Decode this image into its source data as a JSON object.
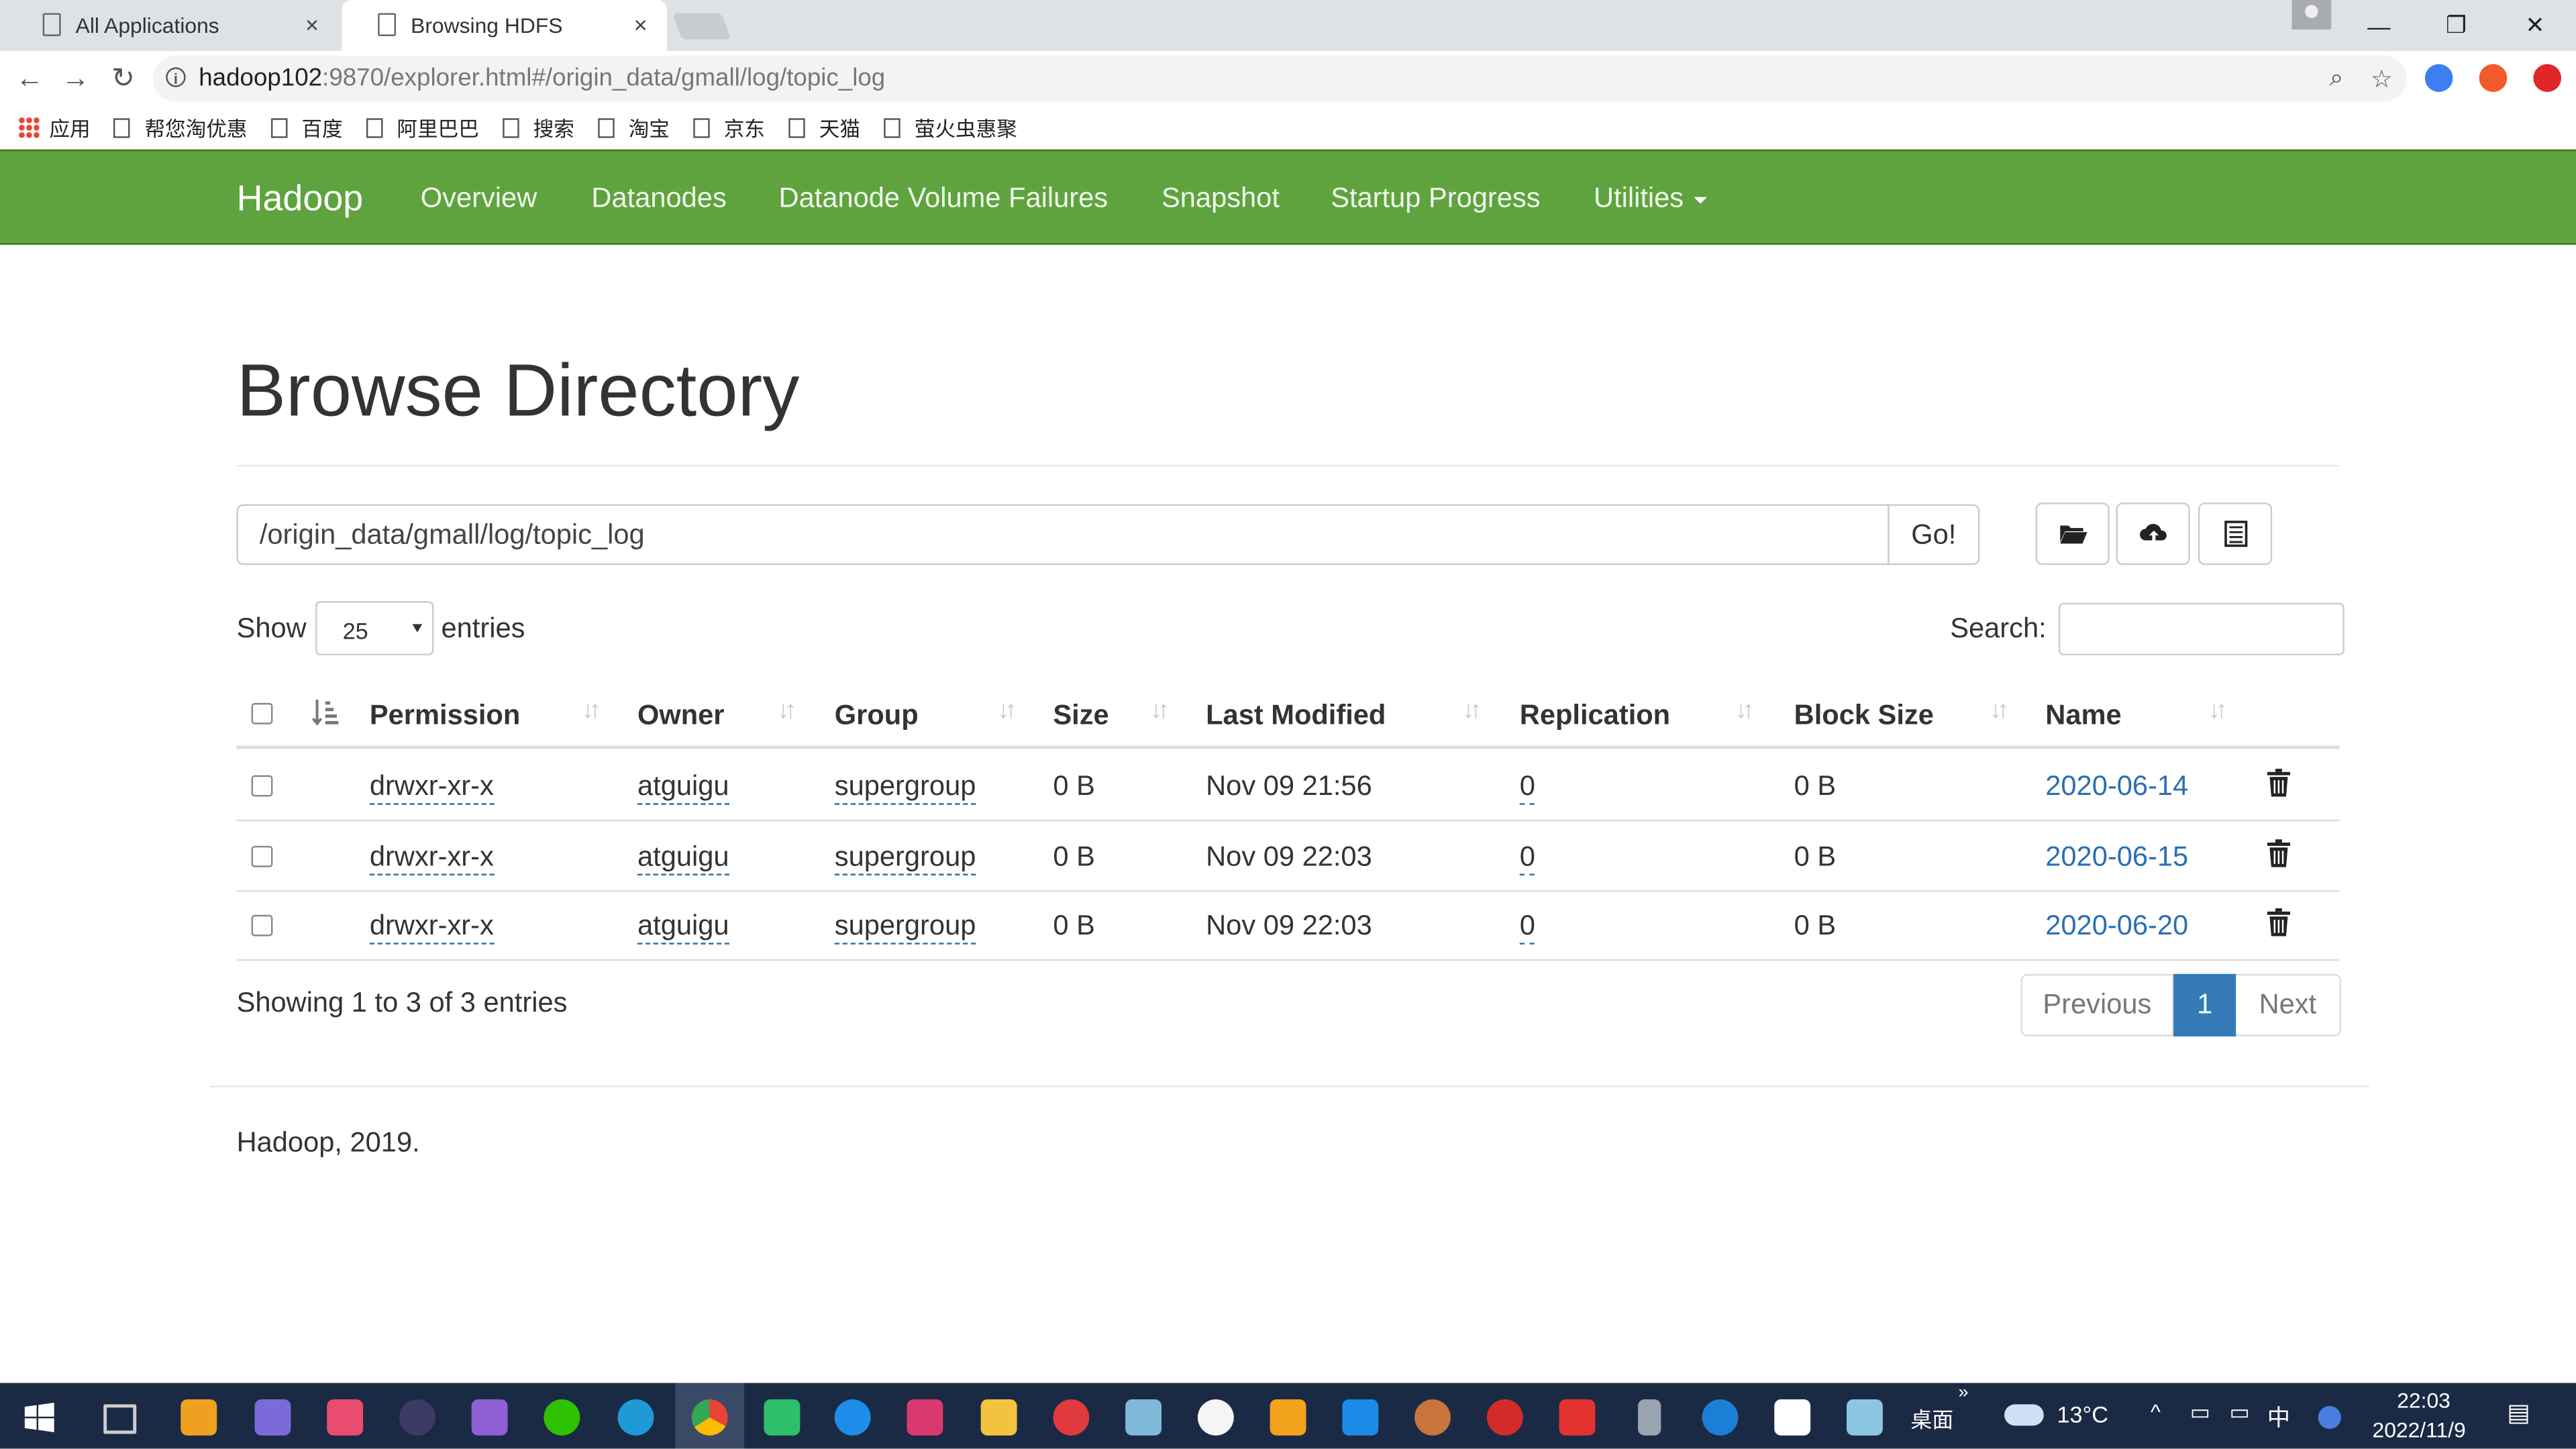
{
  "browser": {
    "tabs": [
      {
        "label": "All Applications",
        "close": "×"
      },
      {
        "label": "Browsing HDFS",
        "close": "×"
      }
    ],
    "url_host": "hadoop102",
    "url_rest": ":9870/explorer.html#/origin_data/gmall/log/topic_log",
    "bookmarks": [
      "应用",
      "帮您淘优惠",
      "百度",
      "阿里巴巴",
      "搜索",
      "淘宝",
      "京东",
      "天猫",
      "萤火虫惠聚"
    ]
  },
  "navbar": {
    "brand": "Hadoop",
    "items": [
      "Overview",
      "Datanodes",
      "Datanode Volume Failures",
      "Snapshot",
      "Startup Progress",
      "Utilities"
    ]
  },
  "page": {
    "title": "Browse Directory",
    "path_value": "/origin_data/gmall/log/topic_log",
    "go_label": "Go!",
    "show_label": "Show",
    "entries_label": "entries",
    "page_length": "25",
    "search_label": "Search:"
  },
  "table": {
    "columns": [
      "Permission",
      "Owner",
      "Group",
      "Size",
      "Last Modified",
      "Replication",
      "Block Size",
      "Name"
    ],
    "rows": [
      {
        "permission": "drwxr-xr-x",
        "owner": "atguigu",
        "group": "supergroup",
        "size": "0 B",
        "modified": "Nov 09 21:56",
        "replication": "0",
        "block_size": "0 B",
        "name": "2020-06-14"
      },
      {
        "permission": "drwxr-xr-x",
        "owner": "atguigu",
        "group": "supergroup",
        "size": "0 B",
        "modified": "Nov 09 22:03",
        "replication": "0",
        "block_size": "0 B",
        "name": "2020-06-15"
      },
      {
        "permission": "drwxr-xr-x",
        "owner": "atguigu",
        "group": "supergroup",
        "size": "0 B",
        "modified": "Nov 09 22:03",
        "replication": "0",
        "block_size": "0 B",
        "name": "2020-06-20"
      }
    ],
    "info": "Showing 1 to 3 of 3 entries"
  },
  "pagination": {
    "previous": "Previous",
    "current": "1",
    "next": "Next"
  },
  "footer": "Hadoop, 2019.",
  "taskbar": {
    "desktop": "桌面",
    "weather": "13°C",
    "ime": "中",
    "time": "22:03",
    "date": "2022/11/9"
  },
  "colors": {
    "navbar": "#5fa33e",
    "link": "#2a6fb3",
    "page_active": "#337ab7",
    "taskbar": "#1b2a44"
  }
}
